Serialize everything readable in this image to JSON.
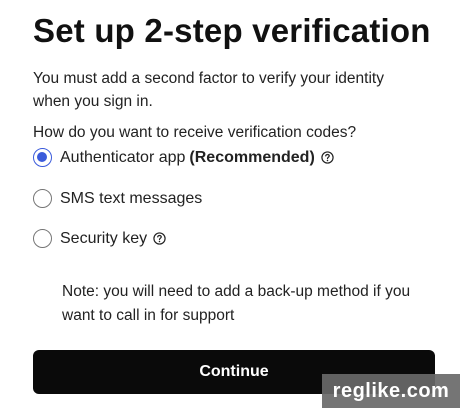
{
  "page": {
    "title": "Set up 2-step verification",
    "intro": "You must add a second factor to verify your identity when you sign in.",
    "question": "How do you want to receive verification codes?"
  },
  "options": [
    {
      "label": "Authenticator app",
      "badge": "(Recommended)",
      "selected": true,
      "help_icon": "help-circle-icon"
    },
    {
      "label": "SMS text messages",
      "selected": false
    },
    {
      "label": "Security key",
      "selected": false,
      "help_icon": "help-circle-icon"
    }
  ],
  "note": "Note: you will need to add a back-up method if you want to call in for support",
  "actions": {
    "continue_label": "Continue"
  },
  "watermark": {
    "text": "reglike.com"
  },
  "colors": {
    "radio_selected": "#3b5bdb",
    "button_bg": "#0a0a0a",
    "button_text": "#ffffff"
  }
}
